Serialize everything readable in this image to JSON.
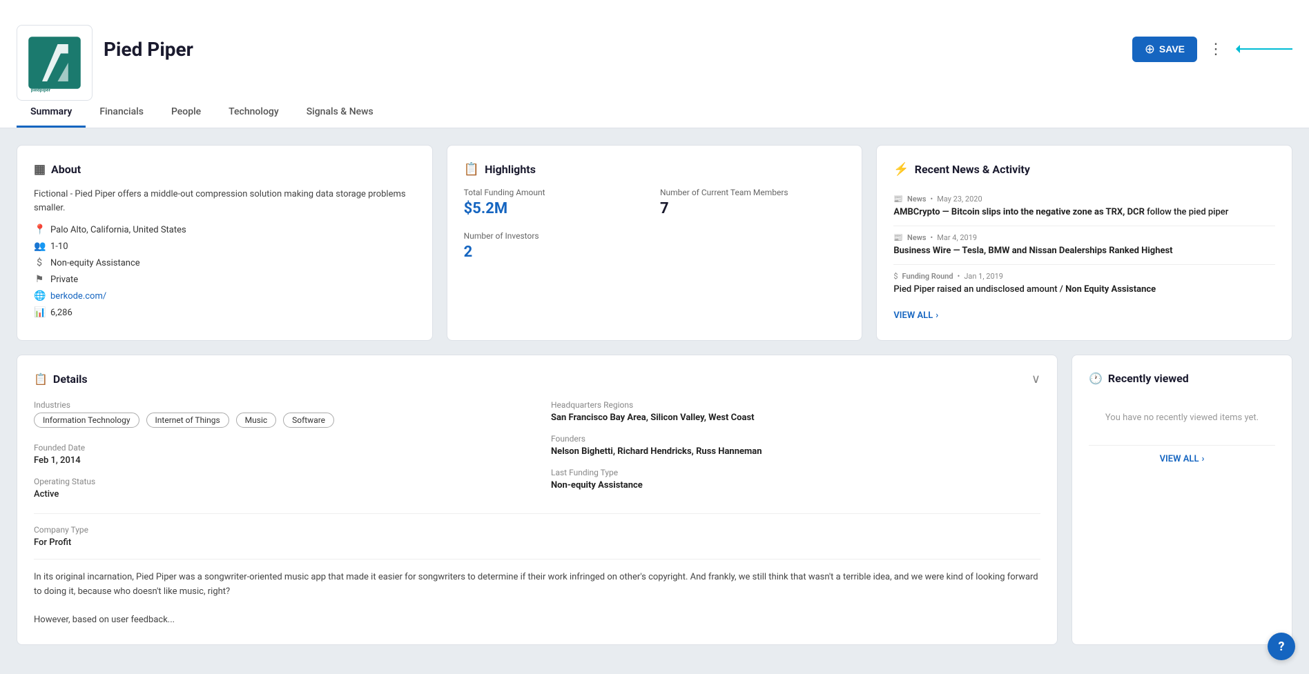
{
  "header": {
    "company_name": "Pied Piper",
    "save_label": "SAVE",
    "nav_tabs": [
      {
        "label": "Summary",
        "active": true
      },
      {
        "label": "Financials",
        "active": false
      },
      {
        "label": "People",
        "active": false
      },
      {
        "label": "Technology",
        "active": false
      },
      {
        "label": "Signals & News",
        "active": false
      }
    ]
  },
  "about": {
    "title": "About",
    "description": "Fictional - Pied Piper offers a middle-out compression solution making data storage problems smaller.",
    "location": "Palo Alto, California, United States",
    "employees": "1-10",
    "funding_type": "Non-equity Assistance",
    "status": "Private",
    "website": "berkode.com/",
    "number": "6,286"
  },
  "highlights": {
    "title": "Highlights",
    "total_funding_label": "Total Funding Amount",
    "total_funding_value": "$5.2M",
    "team_label": "Number of Current Team Members",
    "team_value": "7",
    "investors_label": "Number of Investors",
    "investors_value": "2"
  },
  "recent_news": {
    "title": "Recent News & Activity",
    "items": [
      {
        "type": "News",
        "date": "May 23, 2020",
        "title": "AMBCrypto — Bitcoin slips into the negative zone as TRX, DCR follow the pied piper"
      },
      {
        "type": "News",
        "date": "Mar 4, 2019",
        "title": "Business Wire — Tesla, BMW and Nissan Dealerships Ranked Highest"
      },
      {
        "type": "Funding Round",
        "date": "Jan 1, 2019",
        "title": "Pied Piper raised an undisclosed amount / Non Equity Assistance"
      }
    ],
    "view_all": "VIEW ALL"
  },
  "details": {
    "title": "Details",
    "industries_label": "Industries",
    "industries": [
      "Information Technology",
      "Internet of Things",
      "Music",
      "Software"
    ],
    "hq_label": "Headquarters Regions",
    "hq_value": "San Francisco Bay Area, Silicon Valley, West Coast",
    "founded_label": "Founded Date",
    "founded_value": "Feb 1, 2014",
    "founders_label": "Founders",
    "founders_value": "Nelson Bighetti, Richard Hendricks, Russ Hanneman",
    "operating_label": "Operating Status",
    "operating_value": "Active",
    "last_funding_label": "Last Funding Type",
    "last_funding_value": "Non-equity Assistance",
    "company_type_label": "Company Type",
    "company_type_value": "For Profit",
    "description": "In its original incarnation, Pied Piper was a songwriter-oriented music app that made it easier for songwriters to determine if their work infringed on other's copyright. And frankly, we still think that wasn't a terrible idea, and we were kind of looking forward to doing it, because who doesn't like music, right?\n\nHowever, based on user feedback..."
  },
  "recently_viewed": {
    "title": "Recently viewed",
    "empty_text": "You have no recently viewed items yet.",
    "view_all": "VIEW ALL"
  },
  "help": {
    "label": "?"
  }
}
